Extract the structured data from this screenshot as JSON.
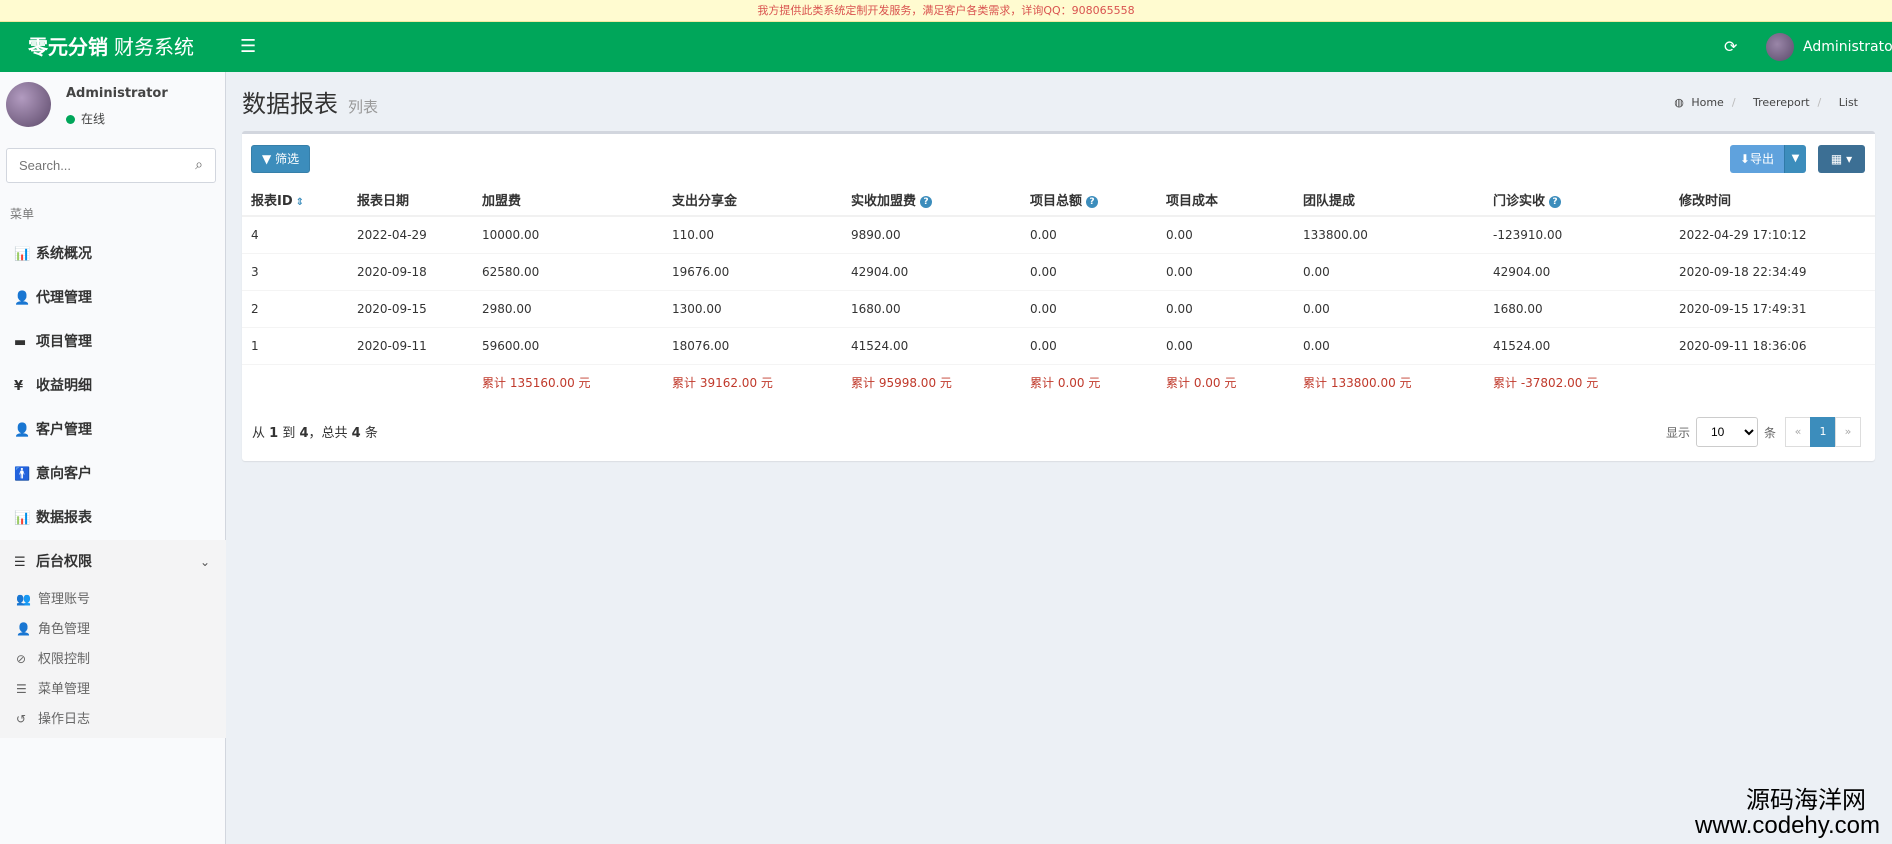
{
  "notice": "我方提供此类系统定制开发服务，满足客户各类需求，详询QQ：908065558",
  "brand": {
    "bold": "零元分销",
    "light": "财务系统"
  },
  "topbar": {
    "username": "Administrator"
  },
  "user_panel": {
    "name": "Administrator",
    "status": "在线",
    "status_color": "#00a65a"
  },
  "search": {
    "placeholder": "Search..."
  },
  "menu_header": "菜单",
  "menu": [
    {
      "label": "系统概况",
      "icon": "bar-chart-icon"
    },
    {
      "label": "代理管理",
      "icon": "user-icon"
    },
    {
      "label": "项目管理",
      "icon": "credit-card-icon"
    },
    {
      "label": "收益明细",
      "icon": "yen-icon"
    },
    {
      "label": "客户管理",
      "icon": "user-tie-icon"
    },
    {
      "label": "意向客户",
      "icon": "person-icon"
    },
    {
      "label": "数据报表",
      "icon": "bar-chart-icon"
    },
    {
      "label": "后台权限",
      "icon": "server-icon"
    }
  ],
  "submenu": [
    {
      "label": "管理账号",
      "icon": "users-icon"
    },
    {
      "label": "角色管理",
      "icon": "user-icon"
    },
    {
      "label": "权限控制",
      "icon": "ban-icon"
    },
    {
      "label": "菜单管理",
      "icon": "bars-icon"
    },
    {
      "label": "操作日志",
      "icon": "history-icon"
    }
  ],
  "page": {
    "title": "数据报表",
    "subtitle": "列表"
  },
  "breadcrumb": {
    "home": "Home",
    "section": "Treereport",
    "current": "List"
  },
  "toolbar": {
    "filter_label": "筛选",
    "export_label": "导出"
  },
  "table": {
    "headers": [
      "报表ID",
      "报表日期",
      "加盟费",
      "支出分享金",
      "实收加盟费",
      "项目总额",
      "项目成本",
      "团队提成",
      "门诊实收",
      "修改时间"
    ],
    "rows": [
      [
        "4",
        "2022-04-29",
        "10000.00",
        "110.00",
        "9890.00",
        "0.00",
        "0.00",
        "133800.00",
        "-123910.00",
        "2022-04-29 17:10:12"
      ],
      [
        "3",
        "2020-09-18",
        "62580.00",
        "19676.00",
        "42904.00",
        "0.00",
        "0.00",
        "0.00",
        "42904.00",
        "2020-09-18 22:34:49"
      ],
      [
        "2",
        "2020-09-15",
        "2980.00",
        "1300.00",
        "1680.00",
        "0.00",
        "0.00",
        "0.00",
        "1680.00",
        "2020-09-15 17:49:31"
      ],
      [
        "1",
        "2020-09-11",
        "59600.00",
        "18076.00",
        "41524.00",
        "0.00",
        "0.00",
        "0.00",
        "41524.00",
        "2020-09-11 18:36:06"
      ]
    ],
    "totals": [
      "",
      "",
      "累计 135160.00 元",
      "累计 39162.00 元",
      "累计 95998.00 元",
      "累计 0.00 元",
      "累计 0.00 元",
      "累计 133800.00 元",
      "累计 -37802.00 元",
      ""
    ]
  },
  "summary": {
    "prefix": "从 ",
    "from": "1",
    "mid1": " 到 ",
    "to": "4",
    "mid2": "，总共 ",
    "total": "4",
    "suffix": " 条"
  },
  "pagination": {
    "show_label": "显示",
    "page_size": "10",
    "unit": "条",
    "prev": "«",
    "current": "1",
    "next": "»"
  },
  "watermark": {
    "cn": "源码海洋网",
    "en": "www.codehy.com"
  },
  "colors": {
    "brand": "#00a65a",
    "primary": "#3c8dbc",
    "total_text": "#c0392b"
  }
}
